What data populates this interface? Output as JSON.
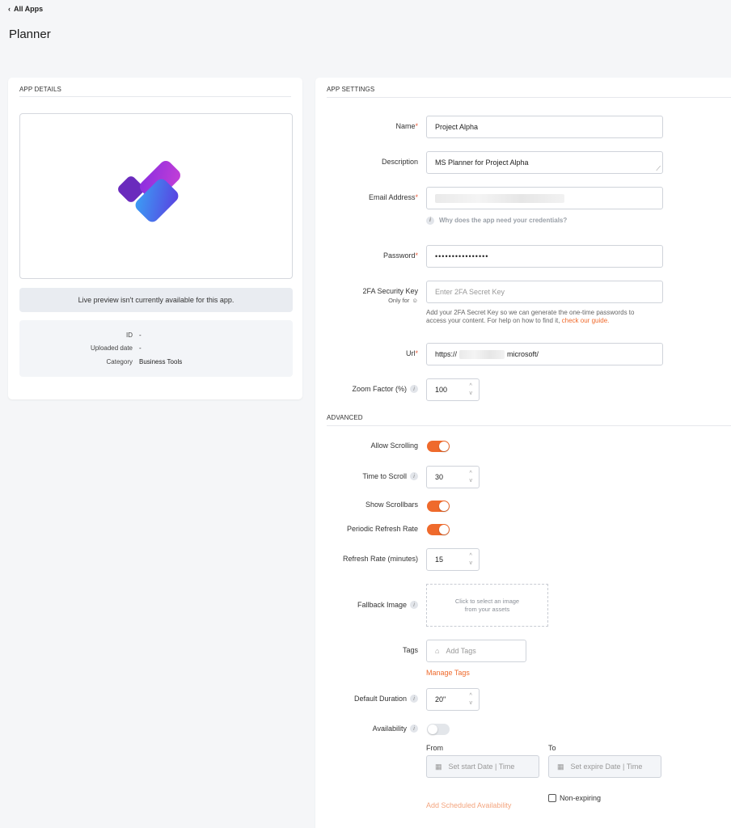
{
  "nav": {
    "back_label": "All Apps"
  },
  "page": {
    "title": "Planner"
  },
  "app_details": {
    "section_title": "APP DETAILS",
    "preview_notice": "Live preview isn't currently available for this app.",
    "meta": [
      {
        "key": "ID",
        "value": "-"
      },
      {
        "key": "Uploaded date",
        "value": "-"
      },
      {
        "key": "Category",
        "value": "Business Tools"
      }
    ]
  },
  "settings": {
    "section_title": "APP SETTINGS",
    "name": {
      "label": "Name",
      "value": "Project Alpha"
    },
    "description": {
      "label": "Description",
      "value": "MS Planner for Project Alpha"
    },
    "email": {
      "label": "Email Address",
      "value": "",
      "help": "Why does the app need your credentials?"
    },
    "password": {
      "label": "Password",
      "value": "••••••••••••••••"
    },
    "twofa": {
      "label": "2FA Security Key",
      "sublabel": "Only for",
      "placeholder": "Enter 2FA Secret Key",
      "help_line1": "Add your 2FA Secret Key so we can generate the one-time passwords to",
      "help_line2_prefix": "access your content. For help on how to find it, ",
      "help_link": "check our guide."
    },
    "url": {
      "label": "Url",
      "prefix": "https://",
      "suffix": "microsoft/"
    },
    "zoom": {
      "label": "Zoom Factor (%)",
      "value": "100"
    }
  },
  "advanced": {
    "section_title": "ADVANCED",
    "allow_scrolling": {
      "label": "Allow Scrolling",
      "on": true
    },
    "time_to_scroll": {
      "label": "Time to Scroll",
      "value": "30"
    },
    "show_scrollbars": {
      "label": "Show Scrollbars",
      "on": true
    },
    "periodic_refresh": {
      "label": "Periodic Refresh Rate",
      "on": true
    },
    "refresh_rate": {
      "label": "Refresh Rate (minutes)",
      "value": "15"
    },
    "fallback_image": {
      "label": "Fallback Image",
      "upload_line1": "Click to select an image",
      "upload_line2": "from your assets"
    },
    "tags": {
      "label": "Tags",
      "placeholder": "Add Tags",
      "manage_link": "Manage Tags"
    },
    "default_duration": {
      "label": "Default Duration",
      "value": "20\""
    },
    "availability": {
      "label": "Availability",
      "on": false,
      "from_label": "From",
      "to_label": "To",
      "start_placeholder": "Set start Date | Time",
      "end_placeholder": "Set expire Date | Time",
      "add_link": "Add Scheduled Availability",
      "non_expiring": "Non-expiring"
    }
  },
  "colors": {
    "accent": "#ef6a2c",
    "required": "#e65c3c",
    "page_bg": "#f5f6f8"
  }
}
